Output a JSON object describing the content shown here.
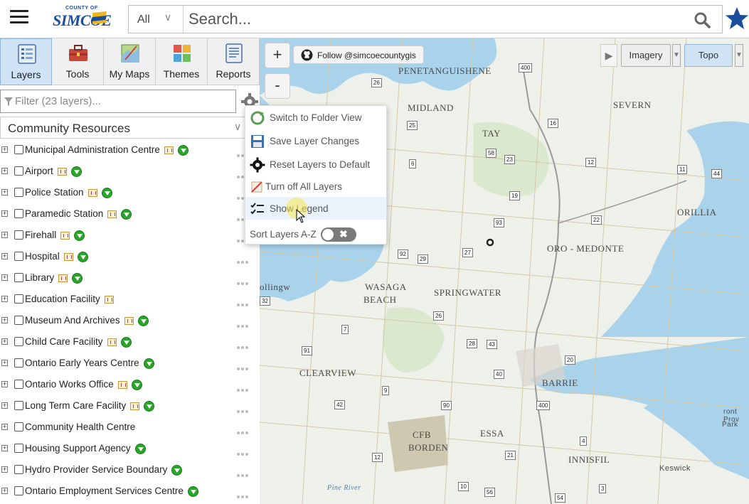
{
  "header": {
    "logo_small": "COUNTY OF",
    "logo_main": "SIMCOE",
    "search_scope": "All",
    "search_placeholder": "Search..."
  },
  "toolbar": {
    "items": [
      {
        "label": "Layers",
        "icon": "layers-icon",
        "active": true
      },
      {
        "label": "Tools",
        "icon": "toolbox-icon"
      },
      {
        "label": "My Maps",
        "icon": "my-maps-icon"
      },
      {
        "label": "Themes",
        "icon": "themes-icon"
      },
      {
        "label": "Reports",
        "icon": "reports-icon"
      }
    ]
  },
  "filter": {
    "placeholder": "Filter (23 layers)..."
  },
  "group": {
    "selected": "Community Resources"
  },
  "layers": [
    {
      "name": "Municipal Administration Centre",
      "legend": true,
      "download": true
    },
    {
      "name": "Airport",
      "legend": true,
      "download": true
    },
    {
      "name": "Police Station",
      "legend": true,
      "download": true
    },
    {
      "name": "Paramedic Station",
      "legend": true,
      "download": true
    },
    {
      "name": "Firehall",
      "legend": true,
      "download": true
    },
    {
      "name": "Hospital",
      "legend": true,
      "download": true
    },
    {
      "name": "Library",
      "legend": true,
      "download": true
    },
    {
      "name": "Education Facility",
      "legend": true,
      "download": false
    },
    {
      "name": "Museum And Archives",
      "legend": true,
      "download": true
    },
    {
      "name": "Child Care Facility",
      "legend": true,
      "download": true
    },
    {
      "name": "Ontario Early Years Centre",
      "legend": false,
      "download": true
    },
    {
      "name": "Ontario Works Office",
      "legend": true,
      "download": true
    },
    {
      "name": "Long Term Care Facility",
      "legend": true,
      "download": true
    },
    {
      "name": "Community Health Centre",
      "legend": false,
      "download": false
    },
    {
      "name": "Housing Support Agency",
      "legend": false,
      "download": true
    },
    {
      "name": "Hydro Provider Service Boundary",
      "legend": false,
      "download": true
    },
    {
      "name": "Ontario Employment Services Centre",
      "legend": false,
      "download": true
    }
  ],
  "menu": {
    "items": [
      {
        "label": "Switch to Folder View",
        "icon": "folder-swap-icon"
      },
      {
        "label": "Save Layer Changes",
        "icon": "save-icon"
      },
      {
        "label": "Reset Layers to Default",
        "icon": "gear-reset-icon"
      },
      {
        "label": "Turn off All Layers",
        "icon": "layers-off-icon"
      },
      {
        "label": "Show Legend",
        "icon": "legend-checklist-icon",
        "highlighted": true
      }
    ],
    "sort_label": "Sort Layers A-Z",
    "sort_enabled": false
  },
  "map": {
    "zoom_in": "+",
    "zoom_out": "-",
    "follow_label": "Follow @simcoecountygis",
    "basemaps": [
      {
        "label": "Imagery",
        "active": false
      },
      {
        "label": "Topo",
        "active": true
      }
    ],
    "labels": [
      "PENETANGUISHENE",
      "MIDLAND",
      "TAY",
      "SEVERN",
      "ORILLIA",
      "ORO - MEDONTE",
      "WASAGA",
      "BEACH",
      "SPRINGWATER",
      "CLEARVIEW",
      "BARRIE",
      "ESSA",
      "CFB",
      "BORDEN",
      "INNISFIL",
      "Keswick",
      "ollingw",
      "Pine River",
      "Park",
      "ront Prov"
    ],
    "road_shields": [
      "400",
      "26",
      "25",
      "16",
      "58",
      "23",
      "12",
      "11",
      "44",
      "6",
      "19",
      "93",
      "22",
      "92",
      "29",
      "27",
      "26",
      "7",
      "28",
      "43",
      "91",
      "20",
      "40",
      "9",
      "400",
      "42",
      "90",
      "4",
      "12",
      "21",
      "10",
      "56",
      "3",
      "54",
      "32"
    ]
  },
  "colors": {
    "water": "#a9d3ea",
    "land": "#eef0ea",
    "accent": "#1b4f9c",
    "download": "#2aa52a"
  }
}
